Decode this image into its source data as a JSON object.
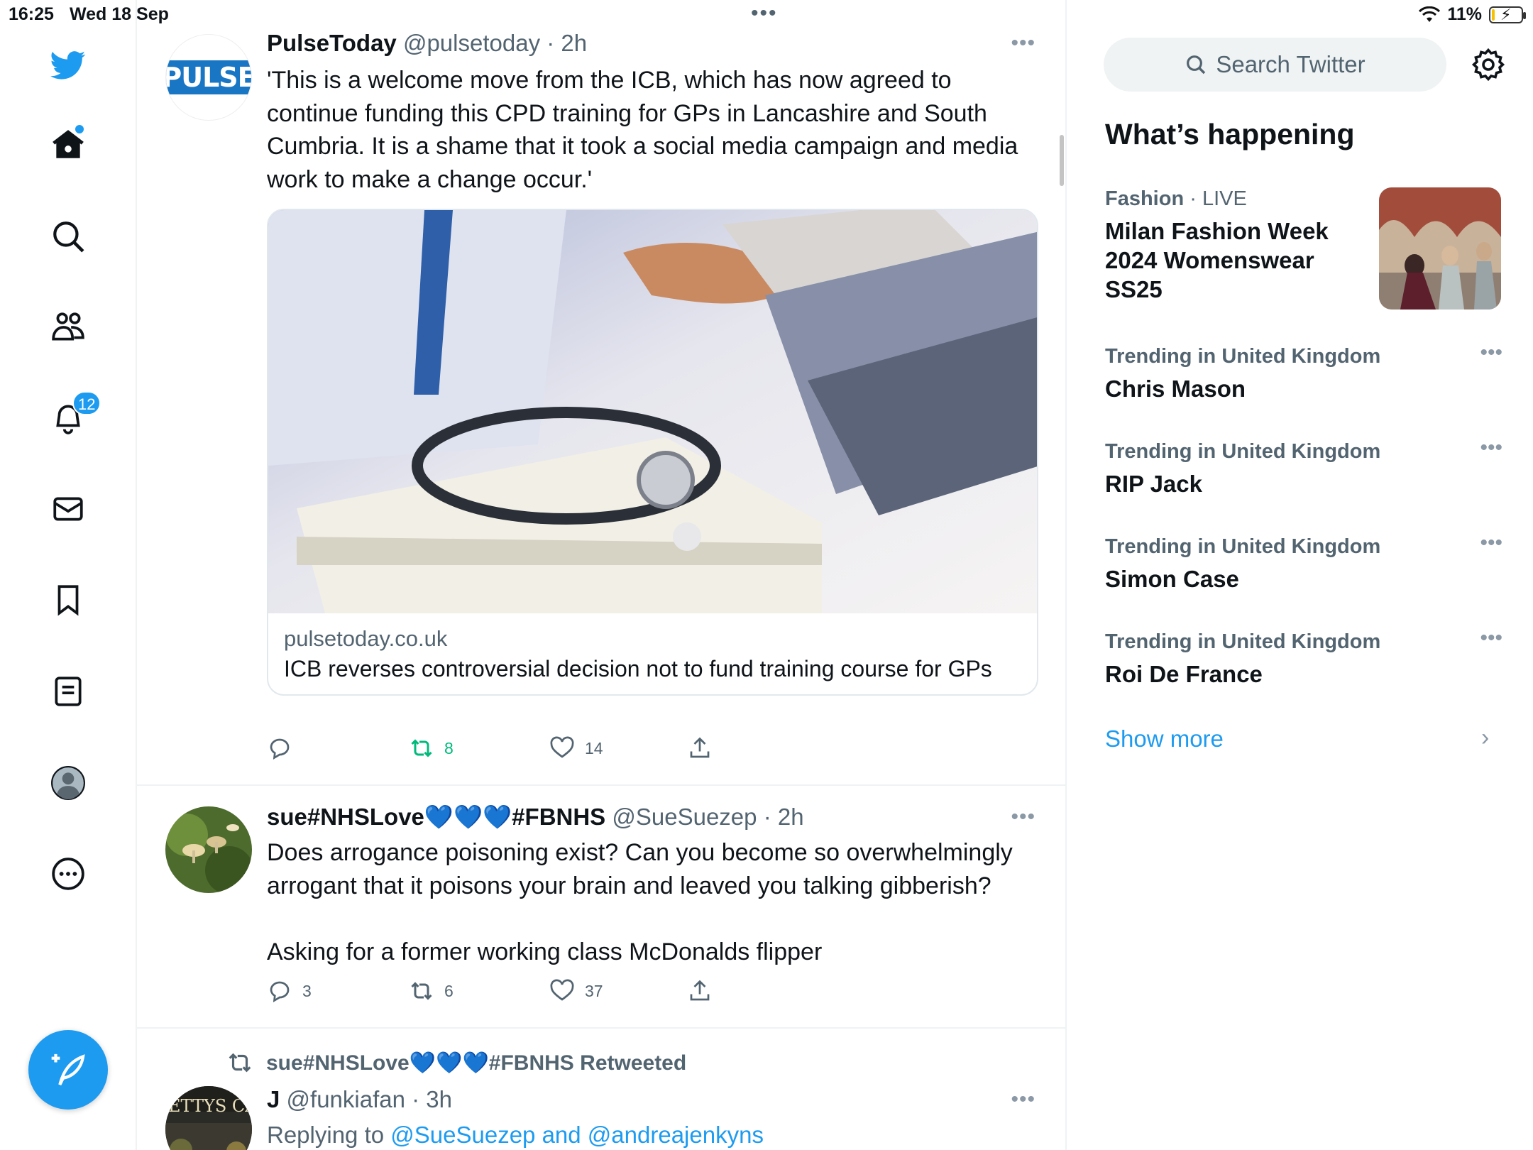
{
  "status_bar": {
    "time": "16:25",
    "date": "Wed 18 Sep",
    "battery": "11%",
    "battery_fill_fraction": 0.11
  },
  "nav": {
    "notifications_badge": "12",
    "items": [
      "twitter-logo",
      "home",
      "explore",
      "communities",
      "notifications",
      "messages",
      "bookmarks",
      "lists",
      "profile",
      "more"
    ]
  },
  "tweets": [
    {
      "name": "PulseToday",
      "handle": "@pulsetoday",
      "time": "· 2h",
      "avatar_text": "PULSE",
      "text_lines": [
        "'This is a welcome move from the ICB, which has now agreed to",
        "continue funding this CPD training for GPs in Lancashire and South",
        "Cumbria. It is a shame that it took a social media campaign and media",
        "work to make a change occur.'"
      ],
      "card": {
        "domain": "pulsetoday.co.uk",
        "title": "ICB reverses controversial decision not to fund training course for GPs"
      },
      "reply_count": "",
      "retweet_count": "8",
      "like_count": "14"
    },
    {
      "name": "sue#NHSLove💙💙💙#FBNHS",
      "handle": "@SueSuezep",
      "time": "· 2h",
      "text_lines": [
        "Does arrogance poisoning exist? Can you become so overwhelmingly",
        "arrogant that it poisons your brain and leaved you talking gibberish?",
        "",
        "Asking for a former working class McDonalds flipper"
      ],
      "reply_count": "3",
      "retweet_count": "6",
      "like_count": "37"
    },
    {
      "retweeted_by": "sue#NHSLove💙💙💙#FBNHS Retweeted",
      "name": "J",
      "handle": "@funkiafan",
      "time": "· 3h",
      "avatar_text": "ETTYS CA",
      "replying_prefix": "Replying to ",
      "replying_to": "@SueSuezep and @andreajenkyns"
    }
  ],
  "sidebar": {
    "search_placeholder": "Search Twitter",
    "title": "What’s happening",
    "featured": {
      "category": "Fashion",
      "live": "· LIVE",
      "topic": "Milan Fashion Week 2024 Womenswear SS25"
    },
    "trends": [
      {
        "context": "Trending in United Kingdom",
        "topic": "Chris Mason"
      },
      {
        "context": "Trending in United Kingdom",
        "topic": "RIP Jack"
      },
      {
        "context": "Trending in United Kingdom",
        "topic": "Simon Case"
      },
      {
        "context": "Trending in United Kingdom",
        "topic": "Roi De France"
      }
    ],
    "show_more": "Show more"
  },
  "colors": {
    "accent": "#1d9bf0",
    "retweet_green": "#00ba7c",
    "text": "#0f1419",
    "muted": "#536471"
  }
}
